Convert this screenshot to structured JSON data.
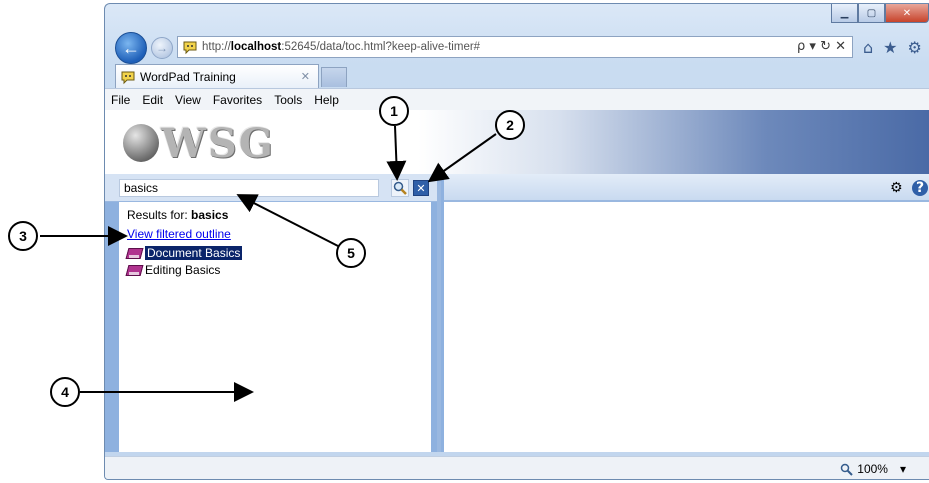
{
  "browser": {
    "address_prefix": "http://",
    "address_host": "localhost",
    "address_rest": ":52645/data/toc.html?keep-alive-timer#",
    "address_tools": "ρ ▾ ↻ ✕",
    "window_minimize": "▁",
    "window_maximize": "▢",
    "window_close": "✕",
    "tab_title": "WordPad Training",
    "tab_close": "✕",
    "menu": [
      "File",
      "Edit",
      "View",
      "Favorites",
      "Tools",
      "Help"
    ],
    "icons": [
      "home-icon",
      "star-icon",
      "gear-icon"
    ]
  },
  "banner": {
    "logo_text": "WSG"
  },
  "search": {
    "value": "basics",
    "results_prefix": "Results for: ",
    "results_term": "basics",
    "filter_link": "View filtered outline",
    "items": [
      "Document Basics",
      "Editing Basics"
    ]
  },
  "status": {
    "zoom": "100%",
    "zoom_arrow": "▾"
  },
  "callouts": [
    "1",
    "2",
    "3",
    "4",
    "5"
  ],
  "colors": {
    "frame_blue": "#8eb1df",
    "selected_bg": "#0a246a",
    "link": "#0000ee"
  }
}
